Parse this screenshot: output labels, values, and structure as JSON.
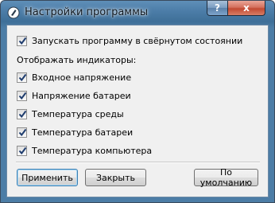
{
  "window": {
    "title": "Настройки программы",
    "help_label": "?",
    "close_label": "x"
  },
  "options": {
    "start_minimized": {
      "label": "Запускать программу в свёрнутом состоянии",
      "checked": true
    },
    "indicators_header": "Отображать индикаторы:",
    "indicators": [
      {
        "label": "Входное напряжение",
        "checked": true
      },
      {
        "label": "Напряжение батареи",
        "checked": true
      },
      {
        "label": "Температура среды",
        "checked": true
      },
      {
        "label": "Температура батареи",
        "checked": true
      },
      {
        "label": "Температура компьютера",
        "checked": true
      }
    ]
  },
  "buttons": {
    "apply": "Применить",
    "close": "Закрыть",
    "defaults": "По умолчанию"
  }
}
